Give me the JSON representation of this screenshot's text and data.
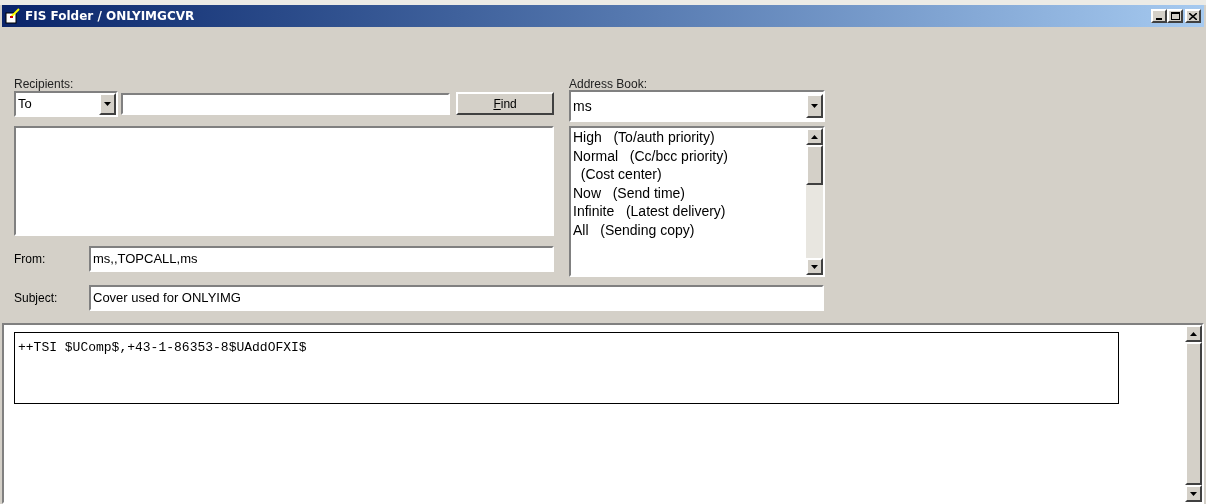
{
  "window": {
    "title": "FIS Folder / ONLYIMGCVR"
  },
  "recipients": {
    "label": "Recipients:",
    "type_value": "To",
    "find_button": "Find"
  },
  "address_book": {
    "label": "Address Book:",
    "value": "ms",
    "options": [
      "High   (To/auth priority)",
      "Normal   (Cc/bcc priority)",
      "  (Cost center)",
      "Now   (Send time)",
      "Infinite   (Latest delivery)",
      "All   (Sending copy)"
    ]
  },
  "from": {
    "label": "From:",
    "value": "ms,,TOPCALL,ms"
  },
  "subject": {
    "label": "Subject:",
    "value": "Cover used for ONLYIMG"
  },
  "body": {
    "text": "++TSI $UComp$,+43-1-86353-8$UAddOFXI$"
  }
}
